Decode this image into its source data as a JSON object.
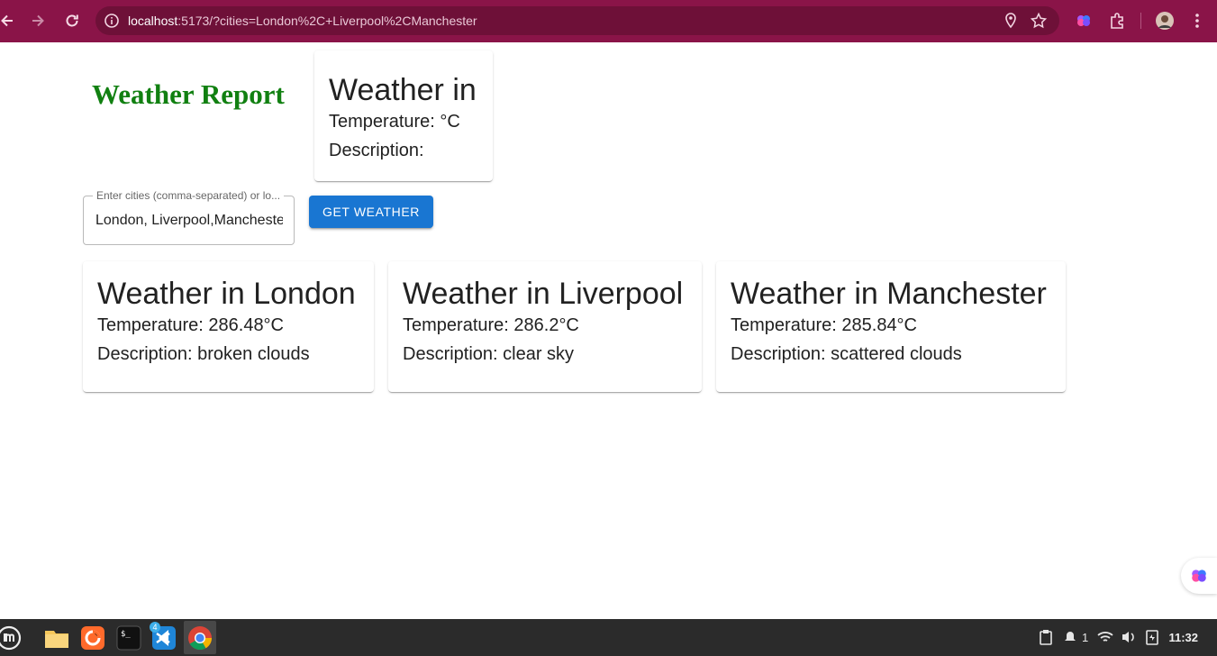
{
  "browser": {
    "url_host": "localhost",
    "url_rest": ":5173/?cities=London%2C+Liverpool%2CManchester",
    "accent": "#8a1448"
  },
  "app": {
    "title": "Weather Report",
    "title_color": "#118011",
    "placeholder_card": {
      "heading": "Weather in",
      "temperature": "Temperature: °C",
      "description": "Description:"
    },
    "search": {
      "label": "Enter cities (comma-separated) or lo...",
      "value": "London, Liverpool,Manchester"
    },
    "get_weather_label": "GET WEATHER",
    "button_color": "#1976d2",
    "cities": [
      {
        "heading": "Weather in London",
        "temperature": "Temperature: 286.48°C",
        "description": "Description: broken clouds"
      },
      {
        "heading": "Weather in Liverpool",
        "temperature": "Temperature: 286.2°C",
        "description": "Description: clear sky"
      },
      {
        "heading": "Weather in Manchester",
        "temperature": "Temperature: 285.84°C",
        "description": "Description: scattered clouds"
      }
    ]
  },
  "taskbar": {
    "apps": [
      "mint-menu-icon",
      "files-icon",
      "firefox-icon",
      "terminal-icon",
      "vscode-icon",
      "chrome-icon"
    ],
    "vscode_badge": "4",
    "notifications_count": "1",
    "clock": "11:32"
  }
}
